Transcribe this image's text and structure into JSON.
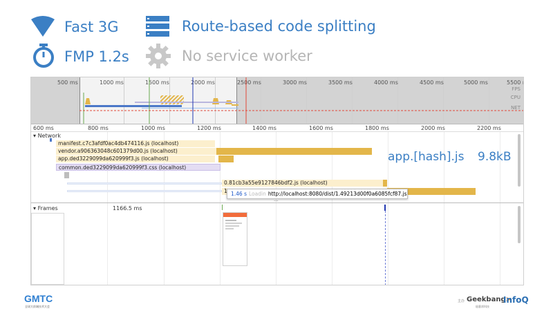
{
  "header": {
    "network": {
      "label": "Fast 3G",
      "icon": "wifi-icon"
    },
    "bundling": {
      "label": "Route-based code splitting",
      "icon": "server-stack-icon"
    },
    "fmp": {
      "label": "FMP 1.2s",
      "icon": "stopwatch-icon"
    },
    "service_worker": {
      "label": "No service worker",
      "icon": "gear-icon"
    }
  },
  "colors": {
    "accent_blue": "#3b7fc4",
    "muted_gray": "#b5b5b5",
    "script_bar": "#e3b64a",
    "script_label_bg": "#fcefcd",
    "stylesheet_label_bg": "#e4ddf3",
    "gmtc_blue": "#2f7fd1"
  },
  "overview": {
    "ticks": [
      "500 ms",
      "1000 ms",
      "1500 ms",
      "2000 ms",
      "2500 ms",
      "3000 ms",
      "3500 ms",
      "4000 ms",
      "4500 ms",
      "5000 ms",
      "5500 r"
    ],
    "lanes": [
      "FPS",
      "CPU",
      "NET"
    ]
  },
  "ruler": {
    "ticks": [
      "600 ms",
      "800 ms",
      "1000 ms",
      "1200 ms",
      "1400 ms",
      "1600 ms",
      "1800 ms",
      "2000 ms",
      "2200 ms"
    ]
  },
  "network": {
    "section_title": "Network",
    "requests": [
      {
        "name": "manifest.c7c3afdf0ac4db474116.js (localhost)"
      },
      {
        "name": "vendor.a906363048c601379d00.js (localhost)"
      },
      {
        "name": "app.ded3229099da620999f3.js (localhost)"
      },
      {
        "name": "common.ded3229099da620999f3.css (localhost)"
      },
      {
        "name": "0.81cb3a55e9127846bdf2.js (localhost)"
      },
      {
        "name": "1"
      }
    ],
    "tooltip": {
      "duration": "1.46 s",
      "label": "Loadin",
      "url": "http://localhost:8080/dist/1.49213d00f0a6085fcf87.js"
    },
    "ellipsis": "..."
  },
  "annotation": {
    "file": "app.[hash].js",
    "size": "9.8kB"
  },
  "frames": {
    "section_title": "Frames",
    "duration": "1166.5 ms"
  },
  "footer": {
    "logo": "GMTC",
    "logo_subtitle": "全球大前端技术大会",
    "sponsor_prefix": "主办",
    "geekbang": "Geekbang",
    "geekbang_suffix": ">",
    "geekbang_sub": "极客邦科技",
    "infoq": "InfoQ"
  }
}
